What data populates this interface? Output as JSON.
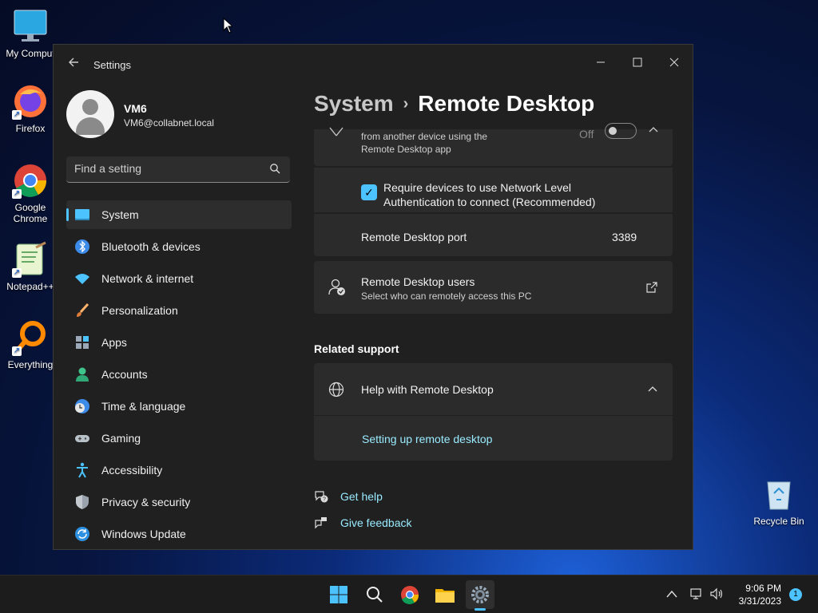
{
  "desktop": {
    "icons": [
      {
        "label": "My Comput",
        "icon": "monitor-icon"
      },
      {
        "label": "Firefox",
        "icon": "firefox-icon"
      },
      {
        "label": "Google Chrome",
        "icon": "chrome-icon"
      },
      {
        "label": "Notepad++",
        "icon": "notepad-plus-plus-icon"
      },
      {
        "label": "Everything",
        "icon": "everything-search-icon"
      },
      {
        "label": "Recycle Bin",
        "icon": "recycle-bin-icon"
      }
    ]
  },
  "window": {
    "title": "Settings",
    "controls": {
      "minimize": "minimize-icon",
      "maximize": "maximize-icon",
      "close": "close-icon"
    }
  },
  "profile": {
    "name": "VM6",
    "email": "VM6@collabnet.local"
  },
  "search": {
    "placeholder": "Find a setting"
  },
  "nav": {
    "items": [
      {
        "label": "System",
        "icon": "system-icon",
        "active": true
      },
      {
        "label": "Bluetooth & devices",
        "icon": "bluetooth-icon"
      },
      {
        "label": "Network & internet",
        "icon": "wifi-icon"
      },
      {
        "label": "Personalization",
        "icon": "brush-icon"
      },
      {
        "label": "Apps",
        "icon": "apps-icon"
      },
      {
        "label": "Accounts",
        "icon": "person-icon"
      },
      {
        "label": "Time & language",
        "icon": "clock-globe-icon"
      },
      {
        "label": "Gaming",
        "icon": "gamepad-icon"
      },
      {
        "label": "Accessibility",
        "icon": "accessibility-icon"
      },
      {
        "label": "Privacy & security",
        "icon": "shield-icon"
      },
      {
        "label": "Windows Update",
        "icon": "update-icon"
      }
    ]
  },
  "breadcrumb": {
    "parent": "System",
    "separator": "›",
    "current": "Remote Desktop"
  },
  "content": {
    "remote_toggle": {
      "description_line1": "from another device using the",
      "description_line2": "Remote Desktop app",
      "state": "Off"
    },
    "nla": {
      "checked": true,
      "label_line1": "Require devices to use Network Level",
      "label_line2": "Authentication to connect (Recommended)"
    },
    "port": {
      "label": "Remote Desktop port",
      "value": "3389"
    },
    "users": {
      "title": "Remote Desktop users",
      "subtitle": "Select who can remotely access this PC"
    },
    "related_support": {
      "title": "Related support",
      "help_title": "Help with Remote Desktop",
      "link": "Setting up remote desktop"
    },
    "footer": {
      "get_help": "Get help",
      "give_feedback": "Give feedback"
    }
  },
  "taskbar": {
    "apps": [
      "start-icon",
      "search-icon",
      "chrome-icon",
      "file-explorer-icon",
      "settings-icon"
    ],
    "time": "9:06 PM",
    "date": "3/31/2023",
    "notification_count": "1"
  },
  "colors": {
    "accent": "#4cc2ff",
    "link": "#99ebff",
    "window_bg": "#202020",
    "card_bg": "#2b2b2b"
  }
}
